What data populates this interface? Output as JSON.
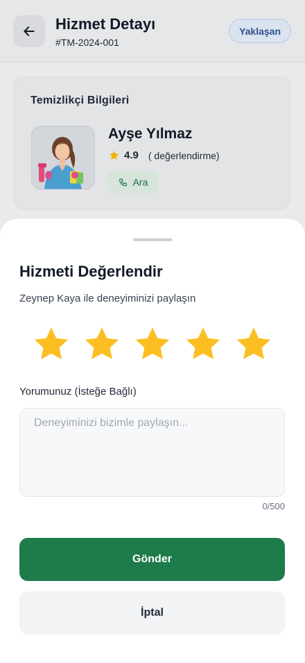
{
  "header": {
    "title": "Hizmet Detayı",
    "order_id": "#TM-2024-001",
    "status": "Yaklaşan"
  },
  "cleaner_card": {
    "title": "Temizlikçi Bilgileri",
    "name": "Ayşe Yılmaz",
    "rating": "4.9",
    "reviews_text": "( değerlendirme)",
    "call_label": "Ara"
  },
  "review_sheet": {
    "title": "Hizmeti Değerlendir",
    "subtitle": "Zeynep Kaya ile deneyiminizi paylaşın",
    "stars_selected": 5,
    "stars_total": 5,
    "comment_label": "Yorumunuz (İsteğe Bağlı)",
    "comment_placeholder": "Deneyiminizi bizimle paylaşın...",
    "comment_value": "",
    "char_counter": "0/500",
    "submit_label": "Gönder",
    "cancel_label": "İptal"
  },
  "colors": {
    "primary": "#1e7b4a",
    "star": "#fbbf24",
    "badge_text": "#2f4f8f"
  }
}
